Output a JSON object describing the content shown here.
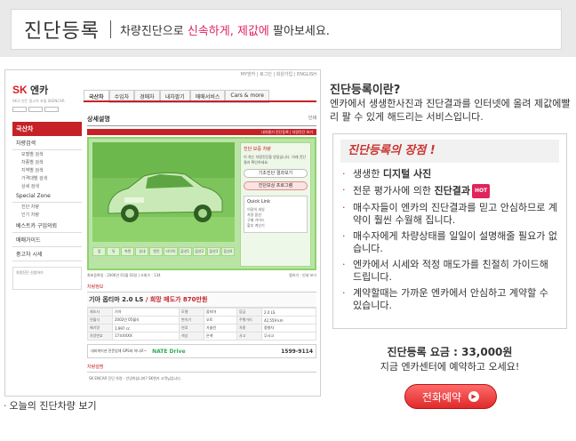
{
  "banner": {
    "title": "진단등록",
    "sub_prefix": "차량진단으로 ",
    "sub_highlight": "신속하게, 제값에",
    "sub_suffix": " 팔아보세요."
  },
  "screenshot": {
    "topline": "MY엔카 | 로그인 | 회원가입 | ENGLISH",
    "logo": {
      "brand": "SK",
      "name": "엔카",
      "sub": "SK가 만든 중고차 포털 SKENCAR"
    },
    "gnb": [
      "국산차",
      "수입차",
      "경매차",
      "내차팔기",
      "매매서비스",
      "Cars & more"
    ],
    "lnb": {
      "head": "국산차",
      "sections": [
        {
          "label": "차량검색",
          "subs": [
            "모델별 검색",
            "차종별 검색",
            "지역별 검색",
            "가격대별 검색",
            "상세 검색"
          ]
        },
        {
          "label": "Special Zone",
          "subs": [
            "진단 차량",
            "인기 차량"
          ]
        },
        {
          "label": "베스트카 구입의뢰",
          "subs": []
        },
        {
          "label": "매매가이드",
          "subs": []
        },
        {
          "label": "중고차 시세",
          "subs": []
        }
      ],
      "promo": "차량진단 신청하기"
    },
    "content_title": "상세설명",
    "content_title_right": "인쇄",
    "redbar": "내차팔기 진단등록 | 차량진단 보기",
    "thumbs": [
      "앞",
      "뒤",
      "측면",
      "실내",
      "엔진",
      "타이어",
      "옵션1",
      "옵션2",
      "옵션3",
      "옵션4"
    ],
    "side_title": "진단 보증 차량",
    "side_desc": "이 차는 차량진단을 받았습니다. 아래 진단결과 확인하세요.",
    "side_btn1": "기초진단 결과보기",
    "side_btn2": "진단보상 프로그램",
    "quick_link": "Quick Link",
    "quick_items": [
      "이달의 세일",
      "차량 옵션",
      "구매 가이드",
      "할부 계산기"
    ],
    "meta_left": "최초등록일 : 2006년 01월 03일 | 조회수 : 134",
    "meta_right": "찜하기 · 인쇄 보기",
    "spec_head": "차량정보",
    "spec_model": "기아 옵티마 2.0 LS",
    "spec_price": " / 희망 매도가 870만원",
    "spec_rows": [
      [
        "제조사",
        "기아",
        "모델",
        "옵티마",
        "등급",
        "2.0 LS"
      ],
      [
        "연월식",
        "2002년 05월식",
        "변속기",
        "오토",
        "주행거리",
        "42,559 km"
      ],
      [
        "배기량",
        "1,997 cc",
        "연료",
        "가솔린",
        "차종",
        "중형차"
      ],
      [
        "차량번호",
        "17조XXXX",
        "색상",
        "은색",
        "사고",
        "무사고"
      ]
    ],
    "options_label": "차량옵션",
    "ad_text": "내비게이션 전문업체 GPS와 하나로~",
    "ad_nate": "NATE Drive",
    "ad_phone": "1599-9114",
    "opinion_head": "차량설명",
    "opinion_text": "SK ENCAR 진단 차량 - 안녕하십니까? SK엔카 고객님입니다."
  },
  "right": {
    "title": "진단등록이란?",
    "desc": "엔카에서 생생한사진과 진단결과를 인터넷에 올려 제값에빨리 팔 수 있게 해드리는 서비스입니다.",
    "merit_title": "진단등록의 장점 !",
    "merits": [
      {
        "pre": "생생한 ",
        "bold": "디지털 사진",
        "post": "",
        "hot": ""
      },
      {
        "pre": "전문 평가사에 의한 ",
        "bold": "진단결과",
        "post": "",
        "hot": "HOT"
      },
      {
        "pre": "매수자들이 엔카의 진단결과를 믿고 안심하므로 계약이 훨씬 수월해 집니다.",
        "bold": "",
        "post": "",
        "hot": ""
      },
      {
        "pre": "매수자에게 차량상태를 일일이 설명해줄 필요가 없습니다.",
        "bold": "",
        "post": "",
        "hot": ""
      },
      {
        "pre": "엔카에서 시세와 적정 매도가를 친절히 가이드해 드립니다.",
        "bold": "",
        "post": "",
        "hot": ""
      },
      {
        "pre": "계약할때는 가까운 엔카에서 안심하고 계약할 수 있습니다.",
        "bold": "",
        "post": "",
        "hot": ""
      }
    ],
    "fee": "진단등록 요금 : 33,000원",
    "fee_sub": "지금 엔카센터에 예약하고 오세요!",
    "call_button": "전화예약"
  },
  "footer": {
    "today_link": "오늘의 진단차량 보기"
  },
  "colors": {
    "accent": "#c62127",
    "highlight": "#e0245e",
    "photo_green": "#8fd26b"
  }
}
